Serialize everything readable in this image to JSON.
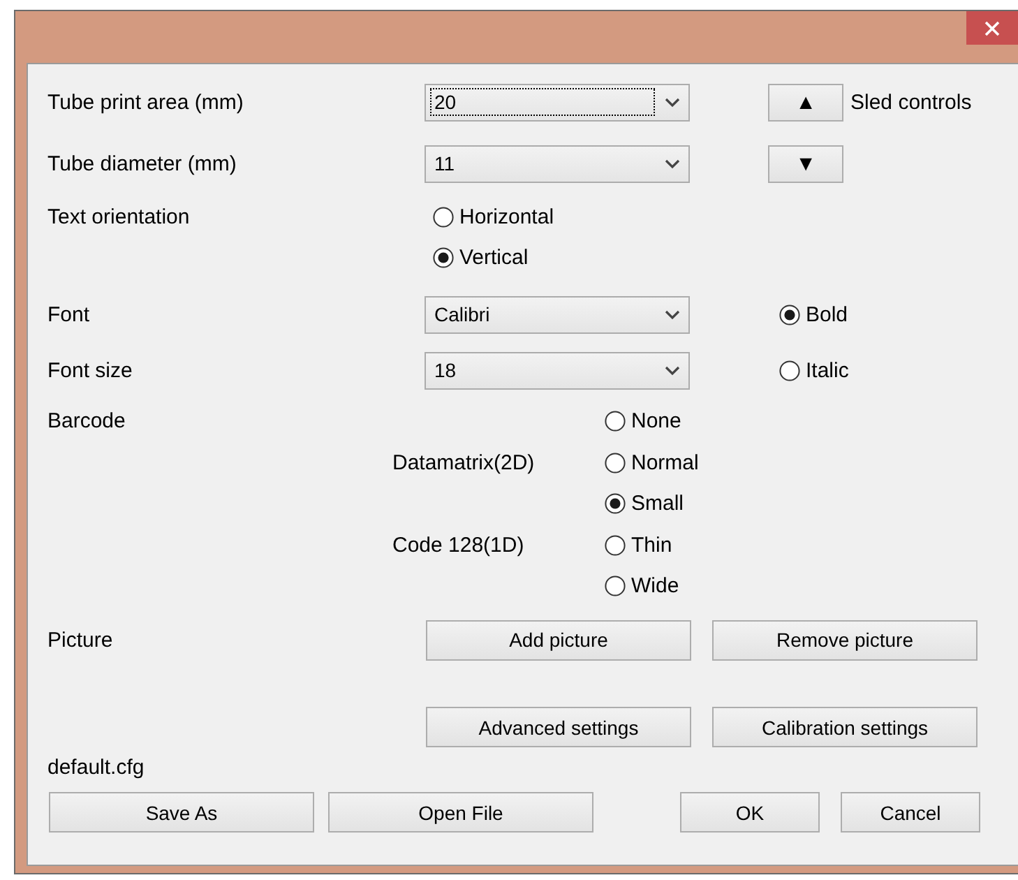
{
  "fields": [
    {
      "label": "Tube print area (mm)",
      "value": "20",
      "focused": true
    },
    {
      "label": "Tube diameter (mm)",
      "value": "11",
      "focused": false
    }
  ],
  "sled_controls": {
    "label": "Sled controls",
    "buttons": [
      "▲",
      "▼"
    ]
  },
  "text_orientation": {
    "label": "Text orientation",
    "options": [
      {
        "label": "Horizontal",
        "selected": false
      },
      {
        "label": "Vertical",
        "selected": true
      }
    ]
  },
  "font": {
    "label": "Font",
    "value": "Calibri"
  },
  "font_size": {
    "label": "Font size",
    "value": "18"
  },
  "style_options": [
    {
      "label": "Bold",
      "selected": true
    },
    {
      "label": "Italic",
      "selected": false
    }
  ],
  "barcode": {
    "label": "Barcode",
    "group_labels": [
      "Datamatrix(2D)",
      "Code 128(1D)"
    ],
    "options": [
      {
        "label": "None",
        "selected": false
      },
      {
        "label": "Normal",
        "selected": false
      },
      {
        "label": "Small",
        "selected": true
      },
      {
        "label": "Thin",
        "selected": false
      },
      {
        "label": "Wide",
        "selected": false
      }
    ]
  },
  "picture": {
    "label": "Picture",
    "buttons": [
      "Add picture",
      "Remove picture"
    ]
  },
  "settings_buttons": [
    "Advanced settings",
    "Calibration settings"
  ],
  "config_file": "default.cfg",
  "file_buttons": [
    "Save As",
    "Open File"
  ],
  "dialog_buttons": [
    "OK",
    "Cancel"
  ]
}
